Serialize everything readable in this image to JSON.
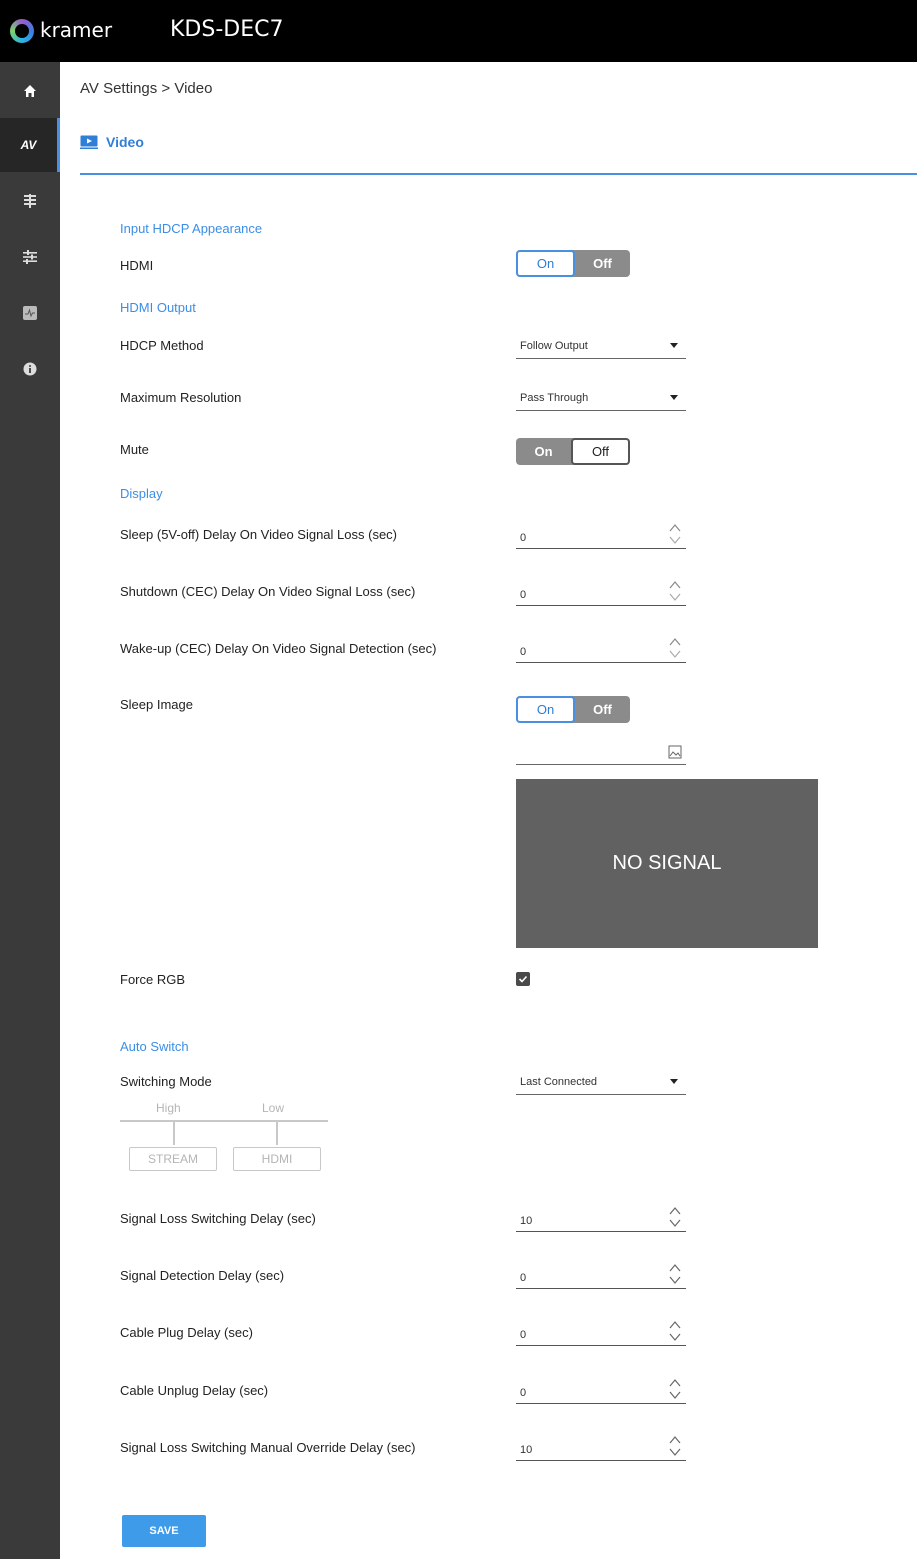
{
  "header": {
    "brand": "kramer",
    "device": "KDS-DEC7"
  },
  "sidebar": {
    "items": [
      {
        "icon": "home-icon"
      },
      {
        "label": "AV",
        "icon": "av-icon"
      },
      {
        "icon": "routing-icon"
      },
      {
        "icon": "settings-sliders-icon"
      },
      {
        "icon": "diagnostics-icon"
      },
      {
        "icon": "info-icon"
      }
    ]
  },
  "breadcrumb": "AV Settings > Video",
  "section": {
    "title": "Video",
    "icon": "video-icon"
  },
  "input_hdcp": {
    "group": "Input HDCP Appearance",
    "hdmi_label": "HDMI",
    "hdmi_toggle": {
      "on": "On",
      "off": "Off",
      "selected": "On"
    }
  },
  "hdmi_output": {
    "group": "HDMI Output",
    "hdcp_method_label": "HDCP Method",
    "hdcp_method_value": "Follow Output",
    "max_res_label": "Maximum Resolution",
    "max_res_value": "Pass Through",
    "mute_label": "Mute",
    "mute_toggle": {
      "on": "On",
      "off": "Off",
      "selected": "Off"
    }
  },
  "display": {
    "group": "Display",
    "sleep_delay_label": "Sleep (5V-off) Delay On Video Signal Loss (sec)",
    "sleep_delay_value": "0",
    "shutdown_delay_label": "Shutdown (CEC) Delay On Video Signal Loss (sec)",
    "shutdown_delay_value": "0",
    "wakeup_delay_label": "Wake-up (CEC) Delay On Video Signal Detection (sec)",
    "wakeup_delay_value": "0",
    "sleep_image_label": "Sleep Image",
    "sleep_image_toggle": {
      "on": "On",
      "off": "Off",
      "selected": "On"
    },
    "preview_text": "NO SIGNAL",
    "force_rgb_label": "Force RGB",
    "force_rgb_checked": true
  },
  "auto_switch": {
    "group": "Auto Switch",
    "mode_label": "Switching Mode",
    "mode_value": "Last Connected",
    "priority_high": "High",
    "priority_low": "Low",
    "priority_first": "STREAM",
    "priority_second": "HDMI",
    "signal_loss_label": "Signal Loss Switching Delay (sec)",
    "signal_loss_value": "10",
    "signal_detect_label": "Signal Detection Delay (sec)",
    "signal_detect_value": "0",
    "cable_plug_label": "Cable Plug Delay (sec)",
    "cable_plug_value": "0",
    "cable_unplug_label": "Cable Unplug Delay (sec)",
    "cable_unplug_value": "0",
    "override_label": "Signal Loss Switching Manual Override Delay (sec)",
    "override_value": "10"
  },
  "save_label": "SAVE",
  "colors": {
    "accent": "#4a90e2",
    "rail": "#3a3a3a",
    "topbar": "#000000"
  }
}
